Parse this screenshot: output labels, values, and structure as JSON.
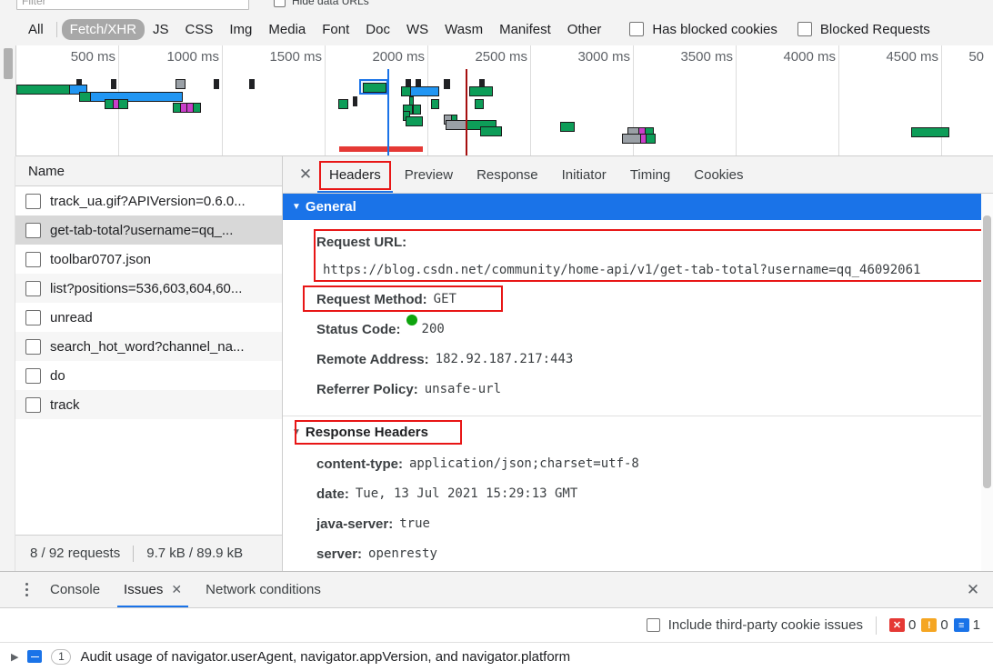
{
  "filter_bar": {
    "filter_placeholder": "Filter",
    "hide_data_urls_label": "Hide data URLs"
  },
  "type_filters": {
    "items": [
      "All",
      "Fetch/XHR",
      "JS",
      "CSS",
      "Img",
      "Media",
      "Font",
      "Doc",
      "WS",
      "Wasm",
      "Manifest",
      "Other"
    ],
    "active": "Fetch/XHR",
    "has_blocked_cookies_label": "Has blocked cookies",
    "blocked_requests_label": "Blocked Requests"
  },
  "overview": {
    "ticks": [
      "500 ms",
      "1000 ms",
      "1500 ms",
      "2000 ms",
      "2500 ms",
      "3000 ms",
      "3500 ms",
      "4000 ms",
      "4500 ms",
      "50"
    ]
  },
  "requests": {
    "column_header": "Name",
    "rows": [
      {
        "name": "track_ua.gif?APIVersion=0.6.0..."
      },
      {
        "name": "get-tab-total?username=qq_..."
      },
      {
        "name": "toolbar0707.json"
      },
      {
        "name": "list?positions=536,603,604,60..."
      },
      {
        "name": "unread"
      },
      {
        "name": "search_hot_word?channel_na..."
      },
      {
        "name": "do"
      },
      {
        "name": "track"
      }
    ],
    "selected_index": 1,
    "status_requests": "8 / 92 requests",
    "status_transfer": "9.7 kB / 89.9 kB"
  },
  "details": {
    "close_icon": "✕",
    "tabs": [
      "Headers",
      "Preview",
      "Response",
      "Initiator",
      "Timing",
      "Cookies"
    ],
    "active_tab": "Headers",
    "general": {
      "title": "General",
      "triangle": "▼",
      "rows": [
        {
          "key": "Request URL:",
          "value": "https://blog.csdn.net/community/home-api/v1/get-tab-total?username=qq_46092061"
        },
        {
          "key": "Request Method:",
          "value": "GET"
        },
        {
          "key": "Status Code:",
          "value": "200"
        },
        {
          "key": "Remote Address:",
          "value": "182.92.187.217:443"
        },
        {
          "key": "Referrer Policy:",
          "value": "unsafe-url"
        }
      ]
    },
    "response_headers": {
      "title": "Response Headers",
      "triangle": "▼",
      "rows": [
        {
          "key": "content-type:",
          "value": "application/json;charset=utf-8"
        },
        {
          "key": "date:",
          "value": "Tue, 13 Jul 2021 15:29:13 GMT"
        },
        {
          "key": "java-server:",
          "value": "true"
        },
        {
          "key": "server:",
          "value": "openresty"
        }
      ]
    }
  },
  "drawer": {
    "tabs": [
      "Console",
      "Issues",
      "Network conditions"
    ],
    "active_tab": "Issues",
    "issues_tab_close": "✕",
    "close_icon": "✕",
    "include_third_party_label": "Include third-party cookie issues",
    "counts": {
      "errors": "0",
      "warnings": "0",
      "info": "1"
    },
    "issue_rows": [
      {
        "arrow": "▶",
        "count": "1",
        "text": "Audit usage of navigator.userAgent, navigator.appVersion, and navigator.platform"
      }
    ]
  },
  "colors": {
    "accent": "#1a73e8",
    "highlight": "#e81616",
    "status_ok": "#0ea40e",
    "panel_bg": "#f3f3f3"
  }
}
